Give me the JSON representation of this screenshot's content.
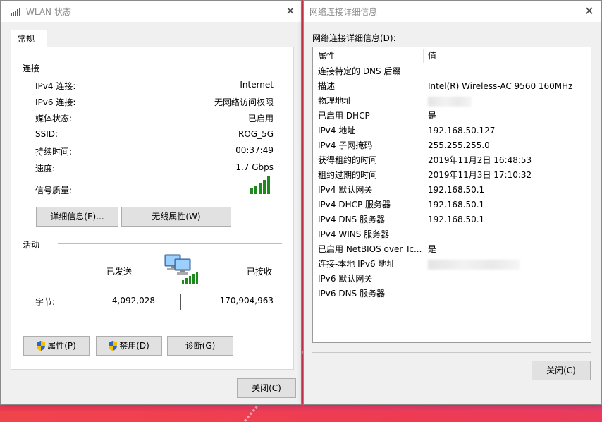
{
  "wlan_window": {
    "title": "WLAN 状态",
    "tab": "常规",
    "connection": {
      "header": "连接",
      "rows": [
        {
          "label": "IPv4 连接:",
          "value": "Internet"
        },
        {
          "label": "IPv6 连接:",
          "value": "无网络访问权限"
        },
        {
          "label": "媒体状态:",
          "value": "已启用"
        },
        {
          "label": "SSID:",
          "value": "ROG_5G"
        },
        {
          "label": "持续时间:",
          "value": "00:37:49"
        },
        {
          "label": "速度:",
          "value": "1.7 Gbps"
        }
      ],
      "signal_label": "信号质量:",
      "signal_bars": 5,
      "details_button": "详细信息(E)...",
      "wireless_props_button": "无线属性(W)"
    },
    "activity": {
      "header": "活动",
      "sent_label": "已发送",
      "received_label": "已接收",
      "bytes_label": "字节:",
      "bytes_sent": "4,092,028",
      "bytes_received": "170,904,963"
    },
    "buttons": {
      "properties": "属性(P)",
      "disable": "禁用(D)",
      "diagnose": "诊断(G)",
      "close": "关闭(C)"
    }
  },
  "details_window": {
    "title": "网络连接详细信息",
    "label": "网络连接详细信息(D):",
    "columns": [
      "属性",
      "值"
    ],
    "rows": [
      {
        "property": "连接特定的 DNS 后缀",
        "value": ""
      },
      {
        "property": "描述",
        "value": "Intel(R) Wireless-AC 9560 160MHz"
      },
      {
        "property": "物理地址",
        "value": ""
      },
      {
        "property": "已启用 DHCP",
        "value": "是"
      },
      {
        "property": "IPv4 地址",
        "value": "192.168.50.127"
      },
      {
        "property": "IPv4 子网掩码",
        "value": "255.255.255.0"
      },
      {
        "property": "获得租约的时间",
        "value": "2019年11月2日 16:48:53"
      },
      {
        "property": "租约过期的时间",
        "value": "2019年11月3日 17:10:32"
      },
      {
        "property": "IPv4 默认网关",
        "value": "192.168.50.1"
      },
      {
        "property": "IPv4 DHCP 服务器",
        "value": "192.168.50.1"
      },
      {
        "property": "IPv4 DNS 服务器",
        "value": "192.168.50.1"
      },
      {
        "property": "IPv4 WINS 服务器",
        "value": ""
      },
      {
        "property": "已启用 NetBIOS over Tc...",
        "value": "是"
      },
      {
        "property": "连接-本地 IPv6 地址",
        "value": ""
      },
      {
        "property": "IPv6 默认网关",
        "value": ""
      },
      {
        "property": "IPv6 DNS 服务器",
        "value": ""
      }
    ],
    "close_button": "关闭(C)"
  },
  "colors": {
    "background": "#ee3b52",
    "signal": "#1e8a1e",
    "shield_blue": "#2b65c8",
    "shield_yellow": "#f5c000"
  }
}
